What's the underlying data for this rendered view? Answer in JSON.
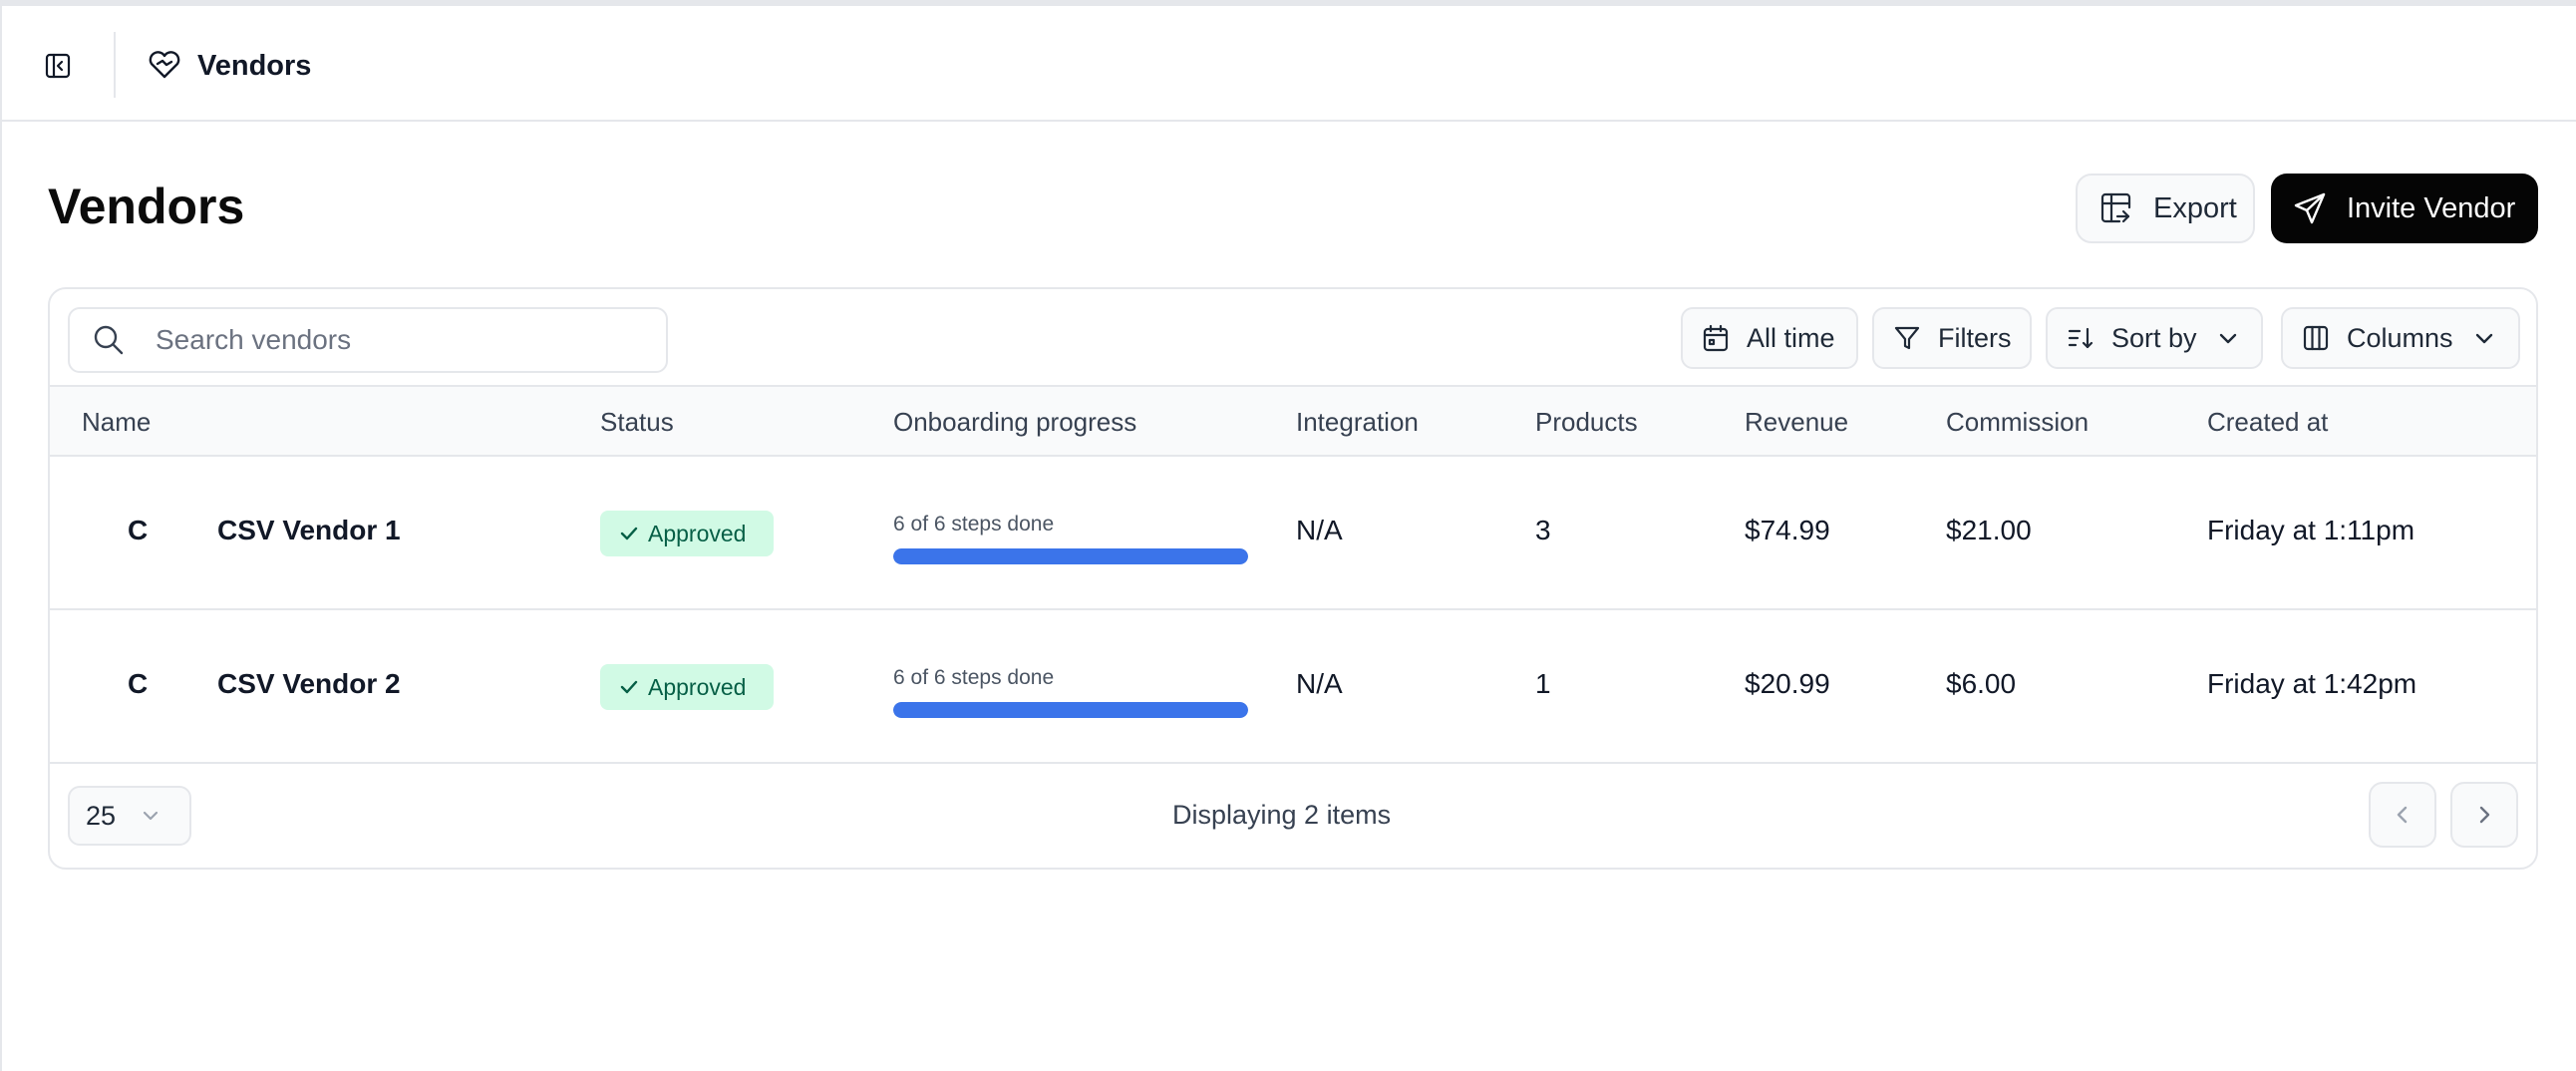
{
  "topbar": {
    "title": "Vendors",
    "sidebar_toggle_icon": "panel-left-icon",
    "section_icon": "handshake-heart-icon"
  },
  "page": {
    "title": "Vendors",
    "export_label": "Export",
    "invite_label": "Invite Vendor"
  },
  "toolbar": {
    "search_placeholder": "Search vendors",
    "search_value": "",
    "date_label": "All time",
    "filters_label": "Filters",
    "sort_label": "Sort by",
    "columns_label": "Columns"
  },
  "table": {
    "headers": [
      "Name",
      "Status",
      "Onboarding progress",
      "Integration",
      "Products",
      "Revenue",
      "Commission",
      "Created at"
    ],
    "rows": [
      {
        "avatar": "C",
        "name": "CSV Vendor 1",
        "status": "Approved",
        "progress_label": "6 of 6 steps done",
        "progress_fraction": 1.0,
        "integration": "N/A",
        "products": "3",
        "revenue": "$74.99",
        "commission": "$21.00",
        "created_at": "Friday at 1:11pm"
      },
      {
        "avatar": "C",
        "name": "CSV Vendor 2",
        "status": "Approved",
        "progress_label": "6 of 6 steps done",
        "progress_fraction": 1.0,
        "integration": "N/A",
        "products": "1",
        "revenue": "$20.99",
        "commission": "$6.00",
        "created_at": "Friday at 1:42pm"
      }
    ]
  },
  "pagination": {
    "page_size": "25",
    "info": "Displaying 2 items"
  },
  "colors": {
    "accent": "#3b74ea",
    "approved_bg": "#d1fae5",
    "approved_text": "#065f46",
    "primary_button": "#050505"
  }
}
